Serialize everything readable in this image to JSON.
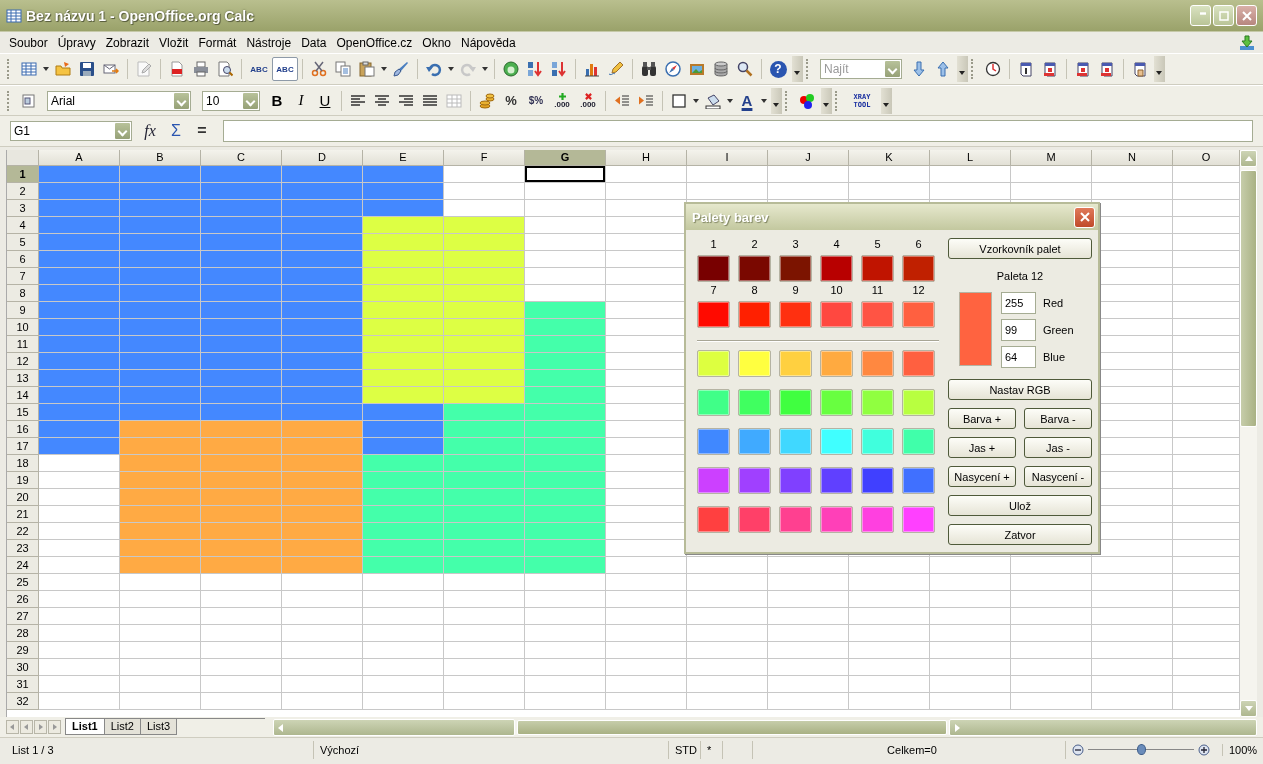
{
  "window": {
    "title": "Bez názvu 1 - OpenOffice.org Calc"
  },
  "menu": [
    {
      "label": "Soubor"
    },
    {
      "label": "Úpravy"
    },
    {
      "label": "Zobrazit"
    },
    {
      "label": "Vložit"
    },
    {
      "label": "Formát"
    },
    {
      "label": "Nástroje"
    },
    {
      "label": "Data"
    },
    {
      "label": "OpenOffice.cz"
    },
    {
      "label": "Okno"
    },
    {
      "label": "Nápověda"
    }
  ],
  "standard_toolbar": {
    "spell": [
      {
        "label": "ABC"
      },
      {
        "label": "ABC",
        "on": true
      }
    ],
    "help": "?",
    "find": {
      "placeholder": "Najít"
    }
  },
  "format_toolbar": {
    "font": "Arial",
    "size": "10",
    "styles": [
      "B",
      "I",
      "U"
    ],
    "percent": "%",
    "currency": "$%",
    "decimals": [
      ".000",
      ".000"
    ],
    "font_color": "A",
    "xray": "XRAY TOOL"
  },
  "formula_bar": {
    "cell": "G1",
    "buttons": [
      "fx",
      "Σ",
      "="
    ]
  },
  "columns": [
    {
      "label": "A",
      "selected": false
    },
    {
      "label": "B",
      "selected": false
    },
    {
      "label": "C",
      "selected": false
    },
    {
      "label": "D",
      "selected": false
    },
    {
      "label": "E",
      "selected": false
    },
    {
      "label": "F",
      "selected": false
    },
    {
      "label": "G",
      "selected": true
    },
    {
      "label": "H",
      "selected": false
    },
    {
      "label": "I",
      "selected": false
    },
    {
      "label": "J",
      "selected": false
    },
    {
      "label": "K",
      "selected": false
    },
    {
      "label": "L",
      "selected": false
    },
    {
      "label": "M",
      "selected": false
    },
    {
      "label": "N",
      "selected": false
    },
    {
      "label": "O",
      "selected": false
    }
  ],
  "rows": [
    {
      "label": "1",
      "selected": true,
      "cells": [
        {
          "color": "#4488ff"
        },
        {
          "color": "#4488ff"
        },
        {
          "color": "#4488ff"
        },
        {
          "color": "#4488ff"
        },
        {
          "color": "#4488ff"
        }
      ]
    },
    {
      "label": "2",
      "selected": false,
      "cells": [
        {
          "color": "#4488ff"
        },
        {
          "color": "#4488ff"
        },
        {
          "color": "#4488ff"
        },
        {
          "color": "#4488ff"
        },
        {
          "color": "#4488ff"
        }
      ]
    },
    {
      "label": "3",
      "selected": false,
      "cells": [
        {
          "color": "#4488ff"
        },
        {
          "color": "#4488ff"
        },
        {
          "color": "#4488ff"
        },
        {
          "color": "#4488ff"
        },
        {
          "color": "#4488ff"
        }
      ]
    },
    {
      "label": "4",
      "selected": false,
      "cells": [
        {
          "color": "#4488ff"
        },
        {
          "color": "#4488ff"
        },
        {
          "color": "#4488ff"
        },
        {
          "color": "#4488ff"
        },
        {
          "color": "#ddff44"
        },
        {
          "color": "#ddff44"
        }
      ]
    },
    {
      "label": "5",
      "selected": false,
      "cells": [
        {
          "color": "#4488ff"
        },
        {
          "color": "#4488ff"
        },
        {
          "color": "#4488ff"
        },
        {
          "color": "#4488ff"
        },
        {
          "color": "#ddff44"
        },
        {
          "color": "#ddff44"
        }
      ]
    },
    {
      "label": "6",
      "selected": false,
      "cells": [
        {
          "color": "#4488ff"
        },
        {
          "color": "#4488ff"
        },
        {
          "color": "#4488ff"
        },
        {
          "color": "#4488ff"
        },
        {
          "color": "#ddff44"
        },
        {
          "color": "#ddff44"
        }
      ]
    },
    {
      "label": "7",
      "selected": false,
      "cells": [
        {
          "color": "#4488ff"
        },
        {
          "color": "#4488ff"
        },
        {
          "color": "#4488ff"
        },
        {
          "color": "#4488ff"
        },
        {
          "color": "#ddff44"
        },
        {
          "color": "#ddff44"
        }
      ]
    },
    {
      "label": "8",
      "selected": false,
      "cells": [
        {
          "color": "#4488ff"
        },
        {
          "color": "#4488ff"
        },
        {
          "color": "#4488ff"
        },
        {
          "color": "#4488ff"
        },
        {
          "color": "#ddff44"
        },
        {
          "color": "#ddff44"
        }
      ]
    },
    {
      "label": "9",
      "selected": false,
      "cells": [
        {
          "color": "#4488ff"
        },
        {
          "color": "#4488ff"
        },
        {
          "color": "#4488ff"
        },
        {
          "color": "#4488ff"
        },
        {
          "color": "#ddff44"
        },
        {
          "color": "#ddff44"
        },
        {
          "color": "#44ffaa"
        }
      ]
    },
    {
      "label": "10",
      "selected": false,
      "cells": [
        {
          "color": "#4488ff"
        },
        {
          "color": "#4488ff"
        },
        {
          "color": "#4488ff"
        },
        {
          "color": "#4488ff"
        },
        {
          "color": "#ddff44"
        },
        {
          "color": "#ddff44"
        },
        {
          "color": "#44ffaa"
        }
      ]
    },
    {
      "label": "11",
      "selected": false,
      "cells": [
        {
          "color": "#4488ff"
        },
        {
          "color": "#4488ff"
        },
        {
          "color": "#4488ff"
        },
        {
          "color": "#4488ff"
        },
        {
          "color": "#ddff44"
        },
        {
          "color": "#ddff44"
        },
        {
          "color": "#44ffaa"
        }
      ]
    },
    {
      "label": "12",
      "selected": false,
      "cells": [
        {
          "color": "#4488ff"
        },
        {
          "color": "#4488ff"
        },
        {
          "color": "#4488ff"
        },
        {
          "color": "#4488ff"
        },
        {
          "color": "#ddff44"
        },
        {
          "color": "#ddff44"
        },
        {
          "color": "#44ffaa"
        }
      ]
    },
    {
      "label": "13",
      "selected": false,
      "cells": [
        {
          "color": "#4488ff"
        },
        {
          "color": "#4488ff"
        },
        {
          "color": "#4488ff"
        },
        {
          "color": "#4488ff"
        },
        {
          "color": "#ddff44"
        },
        {
          "color": "#ddff44"
        },
        {
          "color": "#44ffaa"
        }
      ]
    },
    {
      "label": "14",
      "selected": false,
      "cells": [
        {
          "color": "#4488ff"
        },
        {
          "color": "#4488ff"
        },
        {
          "color": "#4488ff"
        },
        {
          "color": "#4488ff"
        },
        {
          "color": "#ddff44"
        },
        {
          "color": "#ddff44"
        },
        {
          "color": "#44ffaa"
        }
      ]
    },
    {
      "label": "15",
      "selected": false,
      "cells": [
        {
          "color": "#4488ff"
        },
        {
          "color": "#4488ff"
        },
        {
          "color": "#4488ff"
        },
        {
          "color": "#4488ff"
        },
        {
          "color": "#4488ff"
        },
        {
          "color": "#44ffaa"
        },
        {
          "color": "#44ffaa"
        }
      ]
    },
    {
      "label": "16",
      "selected": false,
      "cells": [
        {
          "color": "#4488ff"
        },
        {
          "color": "#ffaa44"
        },
        {
          "color": "#ffaa44"
        },
        {
          "color": "#ffaa44"
        },
        {
          "color": "#4488ff"
        },
        {
          "color": "#44ffaa"
        },
        {
          "color": "#44ffaa"
        }
      ]
    },
    {
      "label": "17",
      "selected": false,
      "cells": [
        {
          "color": "#4488ff"
        },
        {
          "color": "#ffaa44"
        },
        {
          "color": "#ffaa44"
        },
        {
          "color": "#ffaa44"
        },
        {
          "color": "#4488ff"
        },
        {
          "color": "#44ffaa"
        },
        {
          "color": "#44ffaa"
        }
      ]
    },
    {
      "label": "18",
      "selected": false,
      "cells": [
        {},
        {
          "color": "#ffaa44"
        },
        {
          "color": "#ffaa44"
        },
        {
          "color": "#ffaa44"
        },
        {
          "color": "#44ffaa"
        },
        {
          "color": "#44ffaa"
        },
        {
          "color": "#44ffaa"
        }
      ]
    },
    {
      "label": "19",
      "selected": false,
      "cells": [
        {},
        {
          "color": "#ffaa44"
        },
        {
          "color": "#ffaa44"
        },
        {
          "color": "#ffaa44"
        },
        {
          "color": "#44ffaa"
        },
        {
          "color": "#44ffaa"
        },
        {
          "color": "#44ffaa"
        }
      ]
    },
    {
      "label": "20",
      "selected": false,
      "cells": [
        {},
        {
          "color": "#ffaa44"
        },
        {
          "color": "#ffaa44"
        },
        {
          "color": "#ffaa44"
        },
        {
          "color": "#44ffaa"
        },
        {
          "color": "#44ffaa"
        },
        {
          "color": "#44ffaa"
        }
      ]
    },
    {
      "label": "21",
      "selected": false,
      "cells": [
        {},
        {
          "color": "#ffaa44"
        },
        {
          "color": "#ffaa44"
        },
        {
          "color": "#ffaa44"
        },
        {
          "color": "#44ffaa"
        },
        {
          "color": "#44ffaa"
        },
        {
          "color": "#44ffaa"
        }
      ]
    },
    {
      "label": "22",
      "selected": false,
      "cells": [
        {},
        {
          "color": "#ffaa44"
        },
        {
          "color": "#ffaa44"
        },
        {
          "color": "#ffaa44"
        },
        {
          "color": "#44ffaa"
        },
        {
          "color": "#44ffaa"
        },
        {
          "color": "#44ffaa"
        }
      ]
    },
    {
      "label": "23",
      "selected": false,
      "cells": [
        {},
        {
          "color": "#ffaa44"
        },
        {
          "color": "#ffaa44"
        },
        {
          "color": "#ffaa44"
        },
        {
          "color": "#44ffaa"
        },
        {
          "color": "#44ffaa"
        },
        {
          "color": "#44ffaa"
        }
      ]
    },
    {
      "label": "24",
      "selected": false,
      "cells": [
        {},
        {
          "color": "#ffaa44"
        },
        {
          "color": "#ffaa44"
        },
        {
          "color": "#ffaa44"
        },
        {
          "color": "#44ffaa"
        },
        {
          "color": "#44ffaa"
        },
        {
          "color": "#44ffaa"
        }
      ]
    },
    {
      "label": "25",
      "selected": false
    },
    {
      "label": "26",
      "selected": false
    },
    {
      "label": "27",
      "selected": false
    },
    {
      "label": "28",
      "selected": false
    },
    {
      "label": "29",
      "selected": false
    },
    {
      "label": "30",
      "selected": false
    },
    {
      "label": "31",
      "selected": false
    },
    {
      "label": "32",
      "selected": false
    }
  ],
  "sheet_tabs": [
    {
      "label": "List1",
      "selected": true
    },
    {
      "label": "List2",
      "selected": false
    },
    {
      "label": "List3",
      "selected": false
    }
  ],
  "status_bar": {
    "sheet": "List 1 / 3",
    "style": "Výchozí",
    "mode": "STD",
    "modified": "*",
    "sum": "Celkem=0",
    "zoom": {
      "level": 0.5
    },
    "zoom_reading": "100%"
  },
  "dialog": {
    "title": "Palety barev",
    "slots": [
      {
        "label": "1",
        "color": "#780000"
      },
      {
        "label": "2",
        "color": "#7a0800"
      },
      {
        "label": "3",
        "color": "#7c1400"
      },
      {
        "label": "4",
        "color": "#b80000"
      },
      {
        "label": "5",
        "color": "#c01400"
      },
      {
        "label": "6",
        "color": "#c02000"
      },
      {
        "label": "7",
        "color": "#ff0a00"
      },
      {
        "label": "8",
        "color": "#ff2000"
      },
      {
        "label": "9",
        "color": "#ff3010"
      },
      {
        "label": "10",
        "color": "#ff4840"
      },
      {
        "label": "11",
        "color": "#ff5444"
      },
      {
        "label": "12",
        "color": "#ff6040"
      }
    ],
    "swatch_rows": [
      {
        "swatches": [
          {
            "color": "#ddff40"
          },
          {
            "color": "#ffff40"
          },
          {
            "color": "#ffd040"
          },
          {
            "color": "#ffaa40"
          },
          {
            "color": "#ff8840"
          },
          {
            "color": "#ff6040"
          }
        ]
      },
      {
        "swatches": [
          {
            "color": "#40ff88"
          },
          {
            "color": "#40ff60"
          },
          {
            "color": "#40ff40"
          },
          {
            "color": "#68ff40"
          },
          {
            "color": "#90ff40"
          },
          {
            "color": "#b8ff40"
          }
        ]
      },
      {
        "swatches": [
          {
            "color": "#4088ff"
          },
          {
            "color": "#40aaff"
          },
          {
            "color": "#40d8ff"
          },
          {
            "color": "#40ffff"
          },
          {
            "color": "#40ffdd"
          },
          {
            "color": "#40ffaa"
          }
        ]
      },
      {
        "swatches": [
          {
            "color": "#cc40ff"
          },
          {
            "color": "#a040ff"
          },
          {
            "color": "#8040ff"
          },
          {
            "color": "#6040ff"
          },
          {
            "color": "#4040ff"
          },
          {
            "color": "#4070ff"
          }
        ]
      },
      {
        "swatches": [
          {
            "color": "#ff4040"
          },
          {
            "color": "#ff4068"
          },
          {
            "color": "#ff4090"
          },
          {
            "color": "#ff40b8"
          },
          {
            "color": "#ff40e0"
          },
          {
            "color": "#ff40ff"
          }
        ]
      }
    ],
    "palette_button": "Vzorkovník palet",
    "palette_name": "Paleta 12",
    "preview": {
      "color": "#ff6340"
    },
    "rgb": [
      {
        "value": "255",
        "label": "Red"
      },
      {
        "value": "99",
        "label": "Green"
      },
      {
        "value": "64",
        "label": "Blue"
      }
    ],
    "buttons": [
      {
        "label": "Nastav RGB",
        "kind": "wide"
      },
      {
        "label": "Barva +",
        "kind": "half"
      },
      {
        "label": "Barva -",
        "kind": "half"
      },
      {
        "label": "Jas +",
        "kind": "half"
      },
      {
        "label": "Jas -",
        "kind": "half"
      },
      {
        "label": "Nasycení +",
        "kind": "half"
      },
      {
        "label": "Nasycení -",
        "kind": "half"
      },
      {
        "label": "Ulož",
        "kind": "wide"
      },
      {
        "label": "Zatvor",
        "kind": "wide"
      }
    ]
  }
}
